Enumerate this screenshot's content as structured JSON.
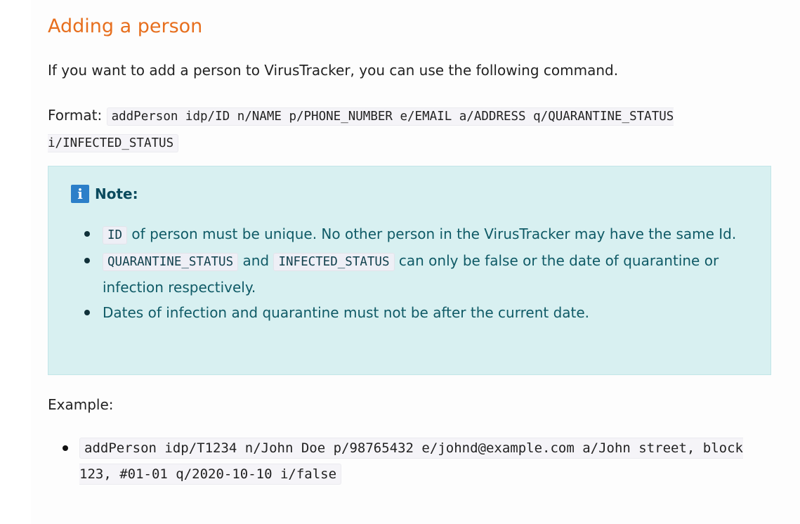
{
  "section": {
    "title": "Adding a person",
    "intro": "If you want to add a person to VirusTracker, you can use the following command.",
    "format_label": "Format:",
    "format_code": "addPerson idp/ID n/NAME p/PHONE_NUMBER e/EMAIL a/ADDRESS q/QUARANTINE_STATUS i/INFECTED_STATUS"
  },
  "note": {
    "icon": "info-icon",
    "icon_glyph": "i",
    "heading": "Note:",
    "item1": {
      "code": "ID",
      "text": " of person must be unique. No other person in the VirusTracker may have the same Id."
    },
    "item2": {
      "code1": "QUARANTINE_STATUS",
      "mid": " and ",
      "code2": "INFECTED_STATUS",
      "text": " can only be false or the date of quarantine or infection respectively."
    },
    "item3": {
      "text": "Dates of infection and quarantine must not be after the current date."
    }
  },
  "example": {
    "label": "Example:",
    "items": [
      "addPerson idp/T1234 n/John Doe p/98765432 e/johnd@example.com a/John street, block 123, #01-01 q/2020-10-10 i/false"
    ]
  },
  "colors": {
    "heading": "#e76f1e",
    "note_bg": "#d8f0f1",
    "note_text": "#0f5a66",
    "info_icon": "#2c7fc9"
  }
}
